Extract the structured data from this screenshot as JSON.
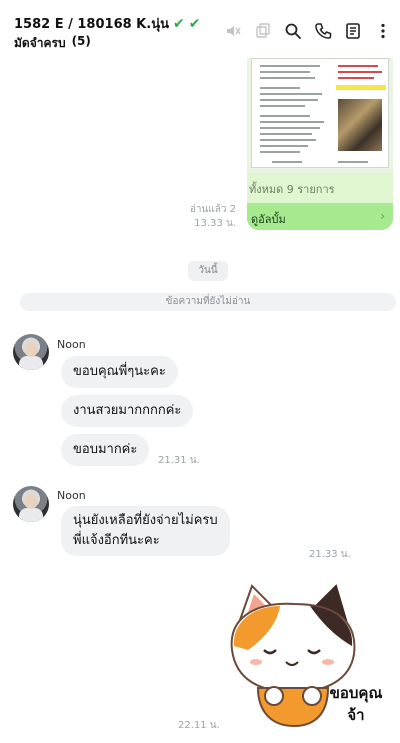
{
  "header": {
    "title": "1582 E / 180168 K.นุ่น",
    "subtitle": "มัดจำครบ",
    "member_count": "(5)",
    "check_color": "#2fa84f"
  },
  "album": {
    "count_text": "ทั้งหมด 9 รายการ",
    "link_label": "ดูอัลบั้ม",
    "bubble_color": "#a6e98f"
  },
  "read_meta": {
    "status": "อ่านแล้ว 2",
    "time": "13.33 น."
  },
  "date_separator": "วันนี้",
  "unread_separator": "ข้อความที่ยังไม่อ่าน",
  "messages": [
    {
      "sender": "Noon",
      "bubbles": [
        "ขอบคุณพี่ๆนะคะ",
        "งานสวยมากกกกค่ะ",
        "ขอบมากค่ะ"
      ],
      "time": "21.31 น."
    },
    {
      "sender": "Noon",
      "bubbles": [
        "นุ่นยังเหลือที่ยังจ่ายไม่ครบ",
        "พี่แจ้งอีกทีนะคะ"
      ],
      "time": "21.33 น."
    }
  ],
  "sticker": {
    "line1": "ขอบคุณ",
    "line2": "จ้า",
    "time": "22.11 น."
  },
  "icons": [
    "speaker-muted-icon",
    "copy-icon",
    "search-icon",
    "phone-icon",
    "notes-icon",
    "more-icon"
  ]
}
